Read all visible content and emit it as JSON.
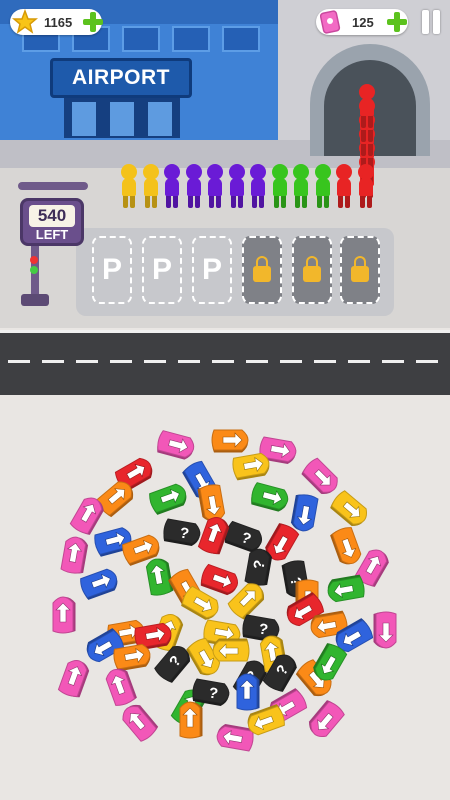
{
  "hud": {
    "stars": "1165",
    "tickets": "125",
    "star_icon": "star-icon",
    "ticket_icon": "ticket-icon",
    "add_icon": "plus-icon",
    "pause_icon": "pause-icon"
  },
  "airport": {
    "sign": "AIRPORT"
  },
  "counter": {
    "number": "540",
    "label": "LEFT"
  },
  "parking": {
    "open_label": "P",
    "slots": [
      "open",
      "open",
      "open",
      "locked",
      "locked",
      "locked"
    ]
  },
  "queue": {
    "colors": [
      "#f4c21a",
      "#f4c21a",
      "#6a1bd6",
      "#6a1bd6",
      "#6a1bd6",
      "#6a1bd6",
      "#6a1bd6",
      "#38c51e",
      "#38c51e",
      "#38c51e",
      "#e82424",
      "#e82424"
    ],
    "tunnel_colors": [
      "#e82424",
      "#e82424",
      "#e82424",
      "#e82424",
      "#e82424",
      "#e82424"
    ]
  },
  "palette": {
    "pink": "#f257b8",
    "red": "#e8262c",
    "orange": "#fb8a17",
    "yellow": "#f9c31b",
    "green": "#31b52f",
    "blue": "#2f63dd",
    "black": "#2b2b2b"
  },
  "cars": [
    {
      "c": "pink",
      "a": 15
    },
    {
      "c": "orange",
      "a": 0
    },
    {
      "c": "pink",
      "a": 10
    },
    {
      "c": "red",
      "a": -30
    },
    {
      "c": "yellow",
      "a": -10
    },
    {
      "c": "blue",
      "a": 60
    },
    {
      "c": "pink",
      "a": 45
    },
    {
      "c": "orange",
      "a": -40
    },
    {
      "c": "green",
      "a": -20
    },
    {
      "c": "orange",
      "a": 80
    },
    {
      "c": "green",
      "a": 15
    },
    {
      "c": "pink",
      "a": -60
    },
    {
      "c": "black",
      "a": 10,
      "m": "?"
    },
    {
      "c": "black",
      "a": 20,
      "m": "?"
    },
    {
      "c": "blue",
      "a": 100
    },
    {
      "c": "yellow",
      "a": 40
    },
    {
      "c": "blue",
      "a": -15
    },
    {
      "c": "orange",
      "a": -20
    },
    {
      "c": "red",
      "a": -70
    },
    {
      "c": "red",
      "a": 120
    },
    {
      "c": "orange",
      "a": 70
    },
    {
      "c": "pink",
      "a": -80
    },
    {
      "c": "green",
      "a": -100
    },
    {
      "c": "black",
      "a": -80,
      "m": "?"
    },
    {
      "c": "black",
      "a": 80,
      "m": "?"
    },
    {
      "c": "orange",
      "a": 60
    },
    {
      "c": "pink",
      "a": -60
    },
    {
      "c": "red",
      "a": 20
    },
    {
      "c": "yellow",
      "a": 30
    },
    {
      "c": "yellow",
      "a": -45
    },
    {
      "c": "orange",
      "a": 90
    },
    {
      "c": "green",
      "a": 170
    },
    {
      "c": "pink",
      "a": -90
    },
    {
      "c": "blue",
      "a": -20
    },
    {
      "c": "orange",
      "a": -10
    },
    {
      "c": "yellow",
      "a": -70
    },
    {
      "c": "yellow",
      "a": 10
    },
    {
      "c": "black",
      "a": 10,
      "m": "?"
    },
    {
      "c": "red",
      "a": 150
    },
    {
      "c": "orange",
      "a": 170
    },
    {
      "c": "blue",
      "a": 150
    },
    {
      "c": "red",
      "a": -10
    },
    {
      "c": "yellow",
      "a": 60
    },
    {
      "c": "black",
      "a": -60,
      "m": "?"
    },
    {
      "c": "yellow",
      "a": 180
    },
    {
      "c": "blue",
      "a": 150
    },
    {
      "c": "pink",
      "a": 90
    },
    {
      "c": "pink",
      "a": -70
    },
    {
      "c": "orange",
      "a": -10
    },
    {
      "c": "black",
      "a": -50,
      "m": "?"
    },
    {
      "c": "yellow",
      "a": -100
    },
    {
      "c": "black",
      "a": -60,
      "m": "?"
    },
    {
      "c": "orange",
      "a": 50
    },
    {
      "c": "green",
      "a": 120
    },
    {
      "c": "pink",
      "a": -110
    },
    {
      "c": "green",
      "a": -60
    },
    {
      "c": "blue",
      "a": -90
    },
    {
      "c": "black",
      "a": 10,
      "m": "?"
    },
    {
      "c": "pink",
      "a": 150
    },
    {
      "c": "pink",
      "a": -130
    },
    {
      "c": "orange",
      "a": -90
    },
    {
      "c": "pink",
      "a": 190
    },
    {
      "c": "yellow",
      "a": 160
    },
    {
      "c": "pink",
      "a": 130
    }
  ]
}
